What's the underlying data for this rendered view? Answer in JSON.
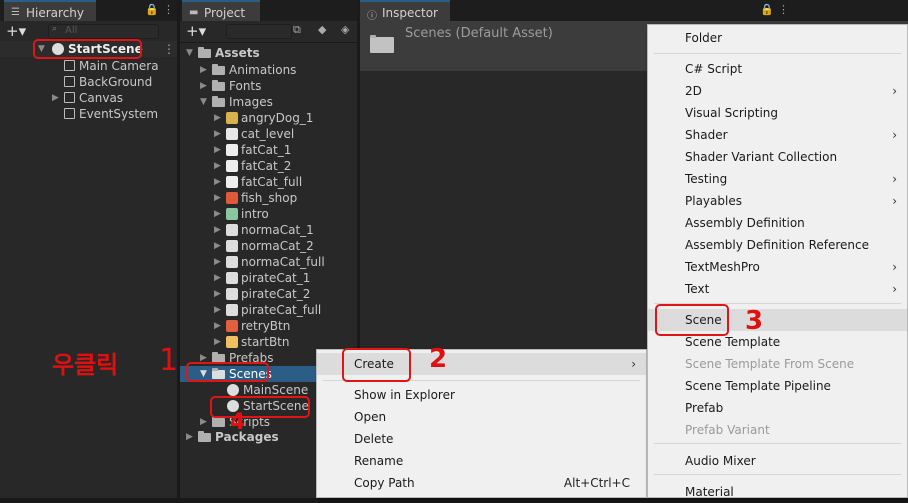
{
  "hierarchy": {
    "tab": "Hierarchy",
    "search_placeholder": "All",
    "scene": "StartScene",
    "items": [
      "Main Camera",
      "BackGround",
      "Canvas",
      "EventSystem"
    ]
  },
  "project": {
    "tab": "Project",
    "root": "Assets",
    "items": [
      "Animations",
      "Fonts",
      "Images"
    ],
    "images": [
      "angryDog_1",
      "cat_level",
      "fatCat_1",
      "fatCat_2",
      "fatCat_full",
      "fish_shop",
      "intro",
      "normaCat_1",
      "normaCat_2",
      "normaCat_full",
      "pirateCat_1",
      "pirateCat_2",
      "pirateCat_full",
      "retryBtn",
      "startBtn"
    ],
    "after": [
      "Prefabs",
      "Scenes"
    ],
    "scenes": [
      "MainScene",
      "StartScene"
    ],
    "tail": [
      "Scripts"
    ],
    "packages": "Packages"
  },
  "inspector": {
    "tab": "Inspector",
    "title": "Scenes (Default Asset)"
  },
  "context_menu": {
    "items": [
      {
        "label": "Create",
        "sub": true
      },
      {
        "label": "Show in Explorer"
      },
      {
        "label": "Open"
      },
      {
        "label": "Delete"
      },
      {
        "label": "Rename"
      },
      {
        "label": "Copy Path",
        "shortcut": "Alt+Ctrl+C"
      }
    ]
  },
  "create_menu": {
    "items": [
      "Folder",
      "C# Script",
      "2D",
      "Visual Scripting",
      "Shader",
      "Shader Variant Collection",
      "Testing",
      "Playables",
      "Assembly Definition",
      "Assembly Definition Reference",
      "TextMeshPro",
      "Text",
      "Scene",
      "Scene Template",
      "Scene Template From Scene",
      "Scene Template Pipeline",
      "Prefab",
      "Prefab Variant",
      "Audio Mixer",
      "Material"
    ]
  },
  "annotations": {
    "n1": "1",
    "n2": "2",
    "n3": "3",
    "n4": "4",
    "right_click": "우클릭"
  }
}
